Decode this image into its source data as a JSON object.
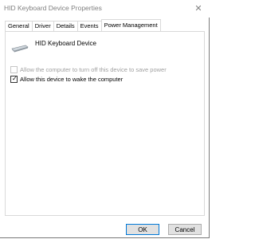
{
  "window": {
    "title": "HID Keyboard Device Properties",
    "close_glyph": "✕"
  },
  "tabs": [
    {
      "label": "General"
    },
    {
      "label": "Driver"
    },
    {
      "label": "Details"
    },
    {
      "label": "Events"
    },
    {
      "label": "Power Management",
      "active": true
    }
  ],
  "device": {
    "name": "HID Keyboard Device",
    "icon": "keyboard-icon"
  },
  "options": [
    {
      "label": "Allow the computer to turn off this device to save power",
      "checked": false,
      "enabled": false
    },
    {
      "label": "Allow this device to wake the computer",
      "checked": true,
      "enabled": true
    }
  ],
  "buttons": {
    "ok": "OK",
    "cancel": "Cancel"
  }
}
